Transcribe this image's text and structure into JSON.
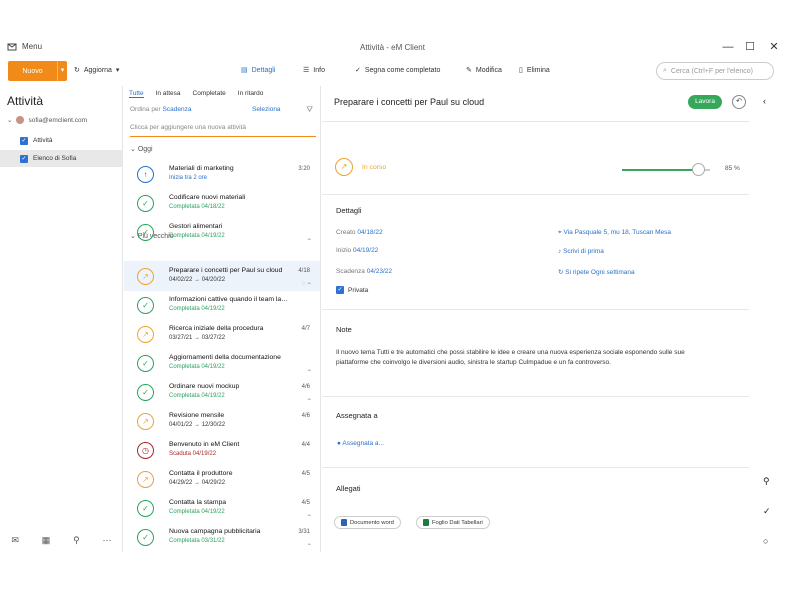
{
  "window": {
    "menu": "Menu",
    "title": "Attività - eM Client",
    "minimize": "—",
    "maximize": "☐",
    "close": "✕"
  },
  "toolbar": {
    "new_label": "Nuovo",
    "new_arrow": "▾",
    "refresh": "Aggiorna",
    "details": "Dettagli",
    "list": "Info",
    "mark_complete": "Segna come completato",
    "edit": "Modifica",
    "delete": "Elimina",
    "search_placeholder": "Cerca (Ctrl+F per l'elenco)"
  },
  "sidebar": {
    "title": "Attività",
    "account": "sofia@emclient.com",
    "items": [
      {
        "label": "Attività"
      },
      {
        "label": "Elenco di Sofia"
      }
    ],
    "bottom_icons": [
      "mail-icon",
      "calendar-icon",
      "contacts-icon",
      "more-icon"
    ]
  },
  "tasks_list": {
    "tabs": [
      "Tutte",
      "In attesa",
      "Completate",
      "In ritardo"
    ],
    "quick_add_prefix": "Ordina per",
    "quick_add_value": "Scadenza",
    "select": "Seleziona",
    "filter": "⛛",
    "placeholder": "Clicca per aggiungere una nuova attività",
    "group_today": "Oggi",
    "group_older": "Più vecchio",
    "items": [
      {
        "title": "Materiali di marketing",
        "subtitle": "Inizia tra 2 ore",
        "date": "3:20",
        "meta": "",
        "icon": "↑",
        "color": "blue",
        "subcolor": "blue"
      },
      {
        "title": "Codificare nuovi materiali",
        "subtitle": "Completata 04/18/22",
        "date": "",
        "meta": "",
        "icon": "✓",
        "color": "green",
        "subcolor": "green"
      },
      {
        "title": "Gestori alimentari",
        "subtitle": "Completata 04/19/22",
        "date": "",
        "meta": "⌁",
        "icon": "✓",
        "color": "green",
        "subcolor": "green"
      },
      {
        "title": "Preparare i concetti per Paul su cloud",
        "subtitle": "04/02/22 → 04/20/22",
        "date": "4/18",
        "meta": "◌ ⌁",
        "icon": "↗",
        "color": "orange",
        "subcolor": "black"
      },
      {
        "title": "Informazioni cattive quando il team lavora",
        "subtitle": "Completata 04/19/22",
        "date": "",
        "meta": "",
        "icon": "✓",
        "color": "green",
        "subcolor": "green"
      },
      {
        "title": "Ricerca iniziale della procedura",
        "subtitle": "03/27/21 → 03/27/22",
        "date": "4/7",
        "meta": "",
        "icon": "↗",
        "color": "orange",
        "subcolor": "black"
      },
      {
        "title": "Aggiornamenti della documentazione",
        "subtitle": "Completata 04/19/22",
        "date": "",
        "meta": "⌁",
        "icon": "✓",
        "color": "green",
        "subcolor": "green"
      },
      {
        "title": "Ordinare nuovi mockup",
        "subtitle": "Completata 04/19/22",
        "date": "4/6",
        "meta": "⌁",
        "icon": "✓",
        "color": "green",
        "subcolor": "green"
      },
      {
        "title": "Revisione mensile",
        "subtitle": "04/01/22 → 12/30/22",
        "date": "4/6",
        "meta": "",
        "icon": "↗",
        "color": "orange",
        "subcolor": "black"
      },
      {
        "title": "Benvenuto in eM Client",
        "subtitle": "Scaduta 04/19/22",
        "date": "4/4",
        "meta": "",
        "icon": "◷",
        "color": "red",
        "subcolor": "red"
      },
      {
        "title": "Contatta il produttore",
        "subtitle": "04/29/22 → 04/29/22",
        "date": "4/5",
        "meta": "",
        "icon": "↗",
        "color": "orange",
        "subcolor": "black"
      },
      {
        "title": "Contatta la stampa",
        "subtitle": "Completata 04/19/22",
        "date": "4/5",
        "meta": "⌁",
        "icon": "✓",
        "color": "green",
        "subcolor": "green"
      },
      {
        "title": "Nuova campagna pubblicitaria",
        "subtitle": "Completata 03/31/22",
        "date": "3/31",
        "meta": "⌁",
        "icon": "✓",
        "color": "green",
        "subcolor": "green"
      }
    ]
  },
  "detail": {
    "title": "Preparare i concetti per Paul su cloud",
    "work_button": "Lavora",
    "reply": "↶",
    "status": "In corso",
    "progress_value": 85,
    "progress_label": "85 %",
    "details_heading": "Dettagli",
    "created_label": "Creato",
    "created_value": "04/18/22",
    "start_label": "Inizio",
    "start_value": "04/19/22",
    "due_label": "Scadenza",
    "due_value": "04/23/22",
    "location": "Via Pasquale 5, mu 18, Tuscan Mesa",
    "reminder": "Scrivi di prima",
    "repeat": "Si ripete Ogni settimana",
    "private": "Privata",
    "notes_heading": "Note",
    "notes_text": "Il nuovo tema Tutti e tre automatici che possi stabilire le idee e creare una nuova esperienza sociale esponendo sulle sue piattaforme che coinvolgo le diversioni audio, sinistra le startup Culmpadue e un fa controverso.",
    "assigned_heading": "Assegnata a",
    "assign_link": "Assegnata a...",
    "attachments_heading": "Allegati",
    "attachments": [
      {
        "name": "Documento word",
        "color": "#2c63b8"
      },
      {
        "name": "Foglio Dati Tabellari",
        "color": "#227a43"
      }
    ]
  },
  "rail_icons": [
    "collapse-icon",
    "contact-icon",
    "done-icon",
    "chat-icon",
    "calendar-icon"
  ]
}
